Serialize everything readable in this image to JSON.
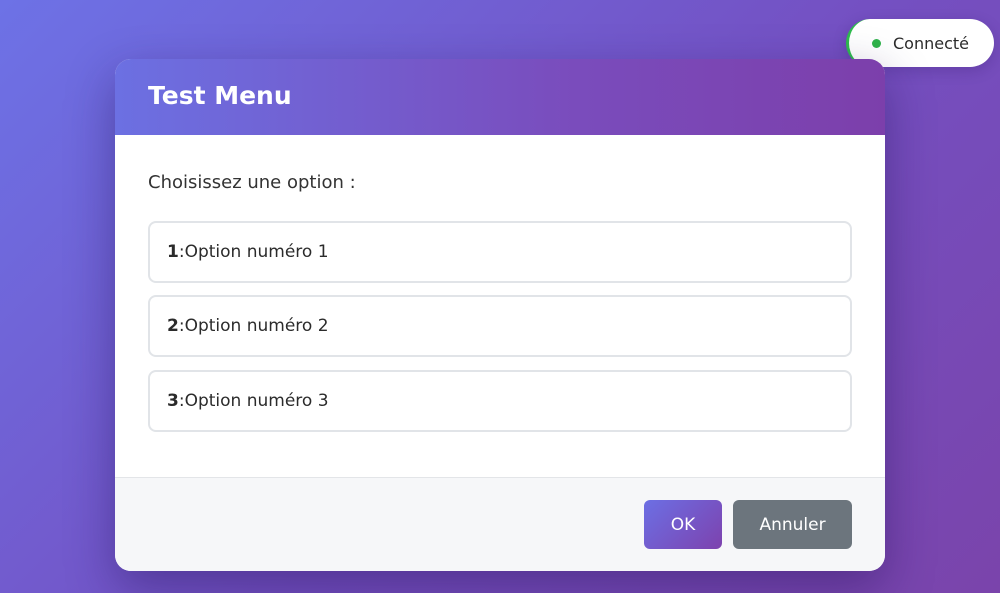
{
  "status": {
    "label": "Connecté",
    "indicator_color": "#2fb34a"
  },
  "dialog": {
    "title": "Test Menu",
    "prompt": "Choisissez une option :",
    "options": [
      {
        "number": "1",
        "separator": ": ",
        "label": "Option numéro 1"
      },
      {
        "number": "2",
        "separator": ": ",
        "label": "Option numéro 2"
      },
      {
        "number": "3",
        "separator": ": ",
        "label": "Option numéro 3"
      }
    ],
    "buttons": {
      "ok_label": "OK",
      "cancel_label": "Annuler"
    }
  },
  "colors": {
    "background_start": "#6d72e6",
    "background_end": "#7a44ab",
    "accent": "#7450c2",
    "cancel_button": "#6c757d"
  }
}
